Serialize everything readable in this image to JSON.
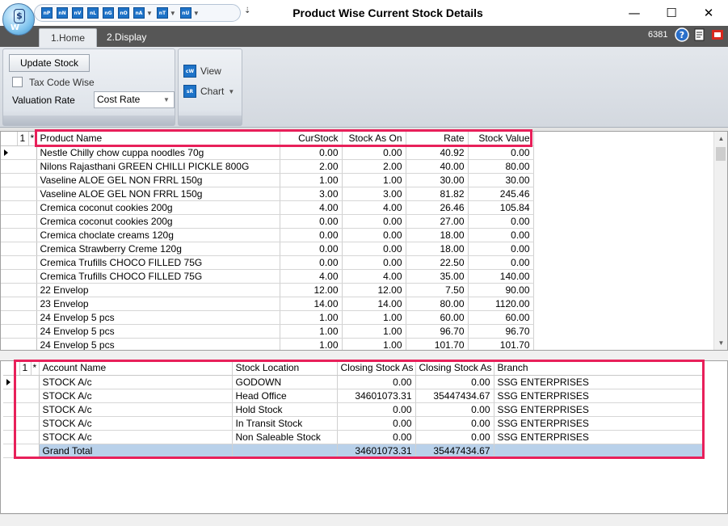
{
  "window": {
    "title": "Product Wise Current Stock Details",
    "minimize": "—",
    "maximize": "☐",
    "close": "✕"
  },
  "quick_access": {
    "buttons": [
      "nP",
      "nN",
      "nV",
      "nL",
      "nG",
      "nO",
      "nA",
      "nT",
      "nU"
    ],
    "more": "⇣"
  },
  "tabs": [
    {
      "label": "1.Home"
    },
    {
      "label": "2.Display"
    }
  ],
  "tabbar_right": {
    "count": "6381"
  },
  "ribbon": {
    "update_stock": "Update Stock",
    "tax_code_wise": "Tax Code Wise",
    "tax_code_wise_checked": false,
    "valuation_rate_label": "Valuation Rate",
    "valuation_rate_value": "Cost Rate",
    "view": "View",
    "chart": "Chart"
  },
  "product_grid": {
    "corner1": "1",
    "corner2": "*",
    "columns": [
      "Product Name",
      "CurStock",
      "Stock As On",
      "Rate",
      "Stock Value"
    ],
    "rows": [
      [
        "Nestle Chilly chow cuppa noodles 70g",
        "0.00",
        "0.00",
        "40.92",
        "0.00"
      ],
      [
        "Nilons Rajasthani GREEN CHILLI PICKLE 800G",
        "2.00",
        "2.00",
        "40.00",
        "80.00"
      ],
      [
        "Vaseline ALOE GEL NON  FRRL 150g",
        "1.00",
        "1.00",
        "30.00",
        "30.00"
      ],
      [
        "Vaseline ALOE GEL NON  FRRL 150g",
        "3.00",
        "3.00",
        "81.82",
        "245.46"
      ],
      [
        "Cremica coconut cookies 200g",
        "4.00",
        "4.00",
        "26.46",
        "105.84"
      ],
      [
        "Cremica coconut cookies 200g",
        "0.00",
        "0.00",
        "27.00",
        "0.00"
      ],
      [
        "Cremica choclate creams 120g",
        "0.00",
        "0.00",
        "18.00",
        "0.00"
      ],
      [
        "Cremica Strawberry Creme 120g",
        "0.00",
        "0.00",
        "18.00",
        "0.00"
      ],
      [
        "Cremica Trufills CHOCO FILLED 75G",
        "0.00",
        "0.00",
        "22.50",
        "0.00"
      ],
      [
        "Cremica Trufills CHOCO FILLED 75G",
        "4.00",
        "4.00",
        "35.00",
        "140.00"
      ],
      [
        "22 Envelop",
        "12.00",
        "12.00",
        "7.50",
        "90.00"
      ],
      [
        "23 Envelop",
        "14.00",
        "14.00",
        "80.00",
        "1120.00"
      ],
      [
        "24 Envelop 5 pcs",
        "1.00",
        "1.00",
        "60.00",
        "60.00"
      ],
      [
        "24 Envelop 5 pcs",
        "1.00",
        "1.00",
        "96.70",
        "96.70"
      ],
      [
        "24 Envelop 5 pcs",
        "1.00",
        "1.00",
        "101.70",
        "101.70"
      ]
    ]
  },
  "account_grid": {
    "corner1": "1",
    "corner2": "*",
    "columns": [
      "Account Name",
      "Stock Location",
      "Closing Stock As",
      "Closing Stock As",
      "Branch"
    ],
    "rows": [
      [
        "STOCK A/c",
        "GODOWN",
        "0.00",
        "0.00",
        "SSG ENTERPRISES"
      ],
      [
        "STOCK A/c",
        "Head Office",
        "34601073.31",
        "35447434.67",
        "SSG ENTERPRISES"
      ],
      [
        "STOCK A/c",
        "Hold Stock",
        "0.00",
        "0.00",
        "SSG ENTERPRISES"
      ],
      [
        "STOCK A/c",
        "In Transit Stock",
        "0.00",
        "0.00",
        "SSG ENTERPRISES"
      ],
      [
        "STOCK A/c",
        "Non Saleable Stock",
        "0.00",
        "0.00",
        "SSG ENTERPRISES"
      ]
    ],
    "total": [
      "Grand Total",
      "",
      "34601073.31",
      "35447434.67",
      ""
    ]
  },
  "colors": {
    "highlight": "#e8205a",
    "tabbar": "#565656",
    "total_row": "#b9d1ea",
    "icon_blue": "#1e73c8"
  }
}
